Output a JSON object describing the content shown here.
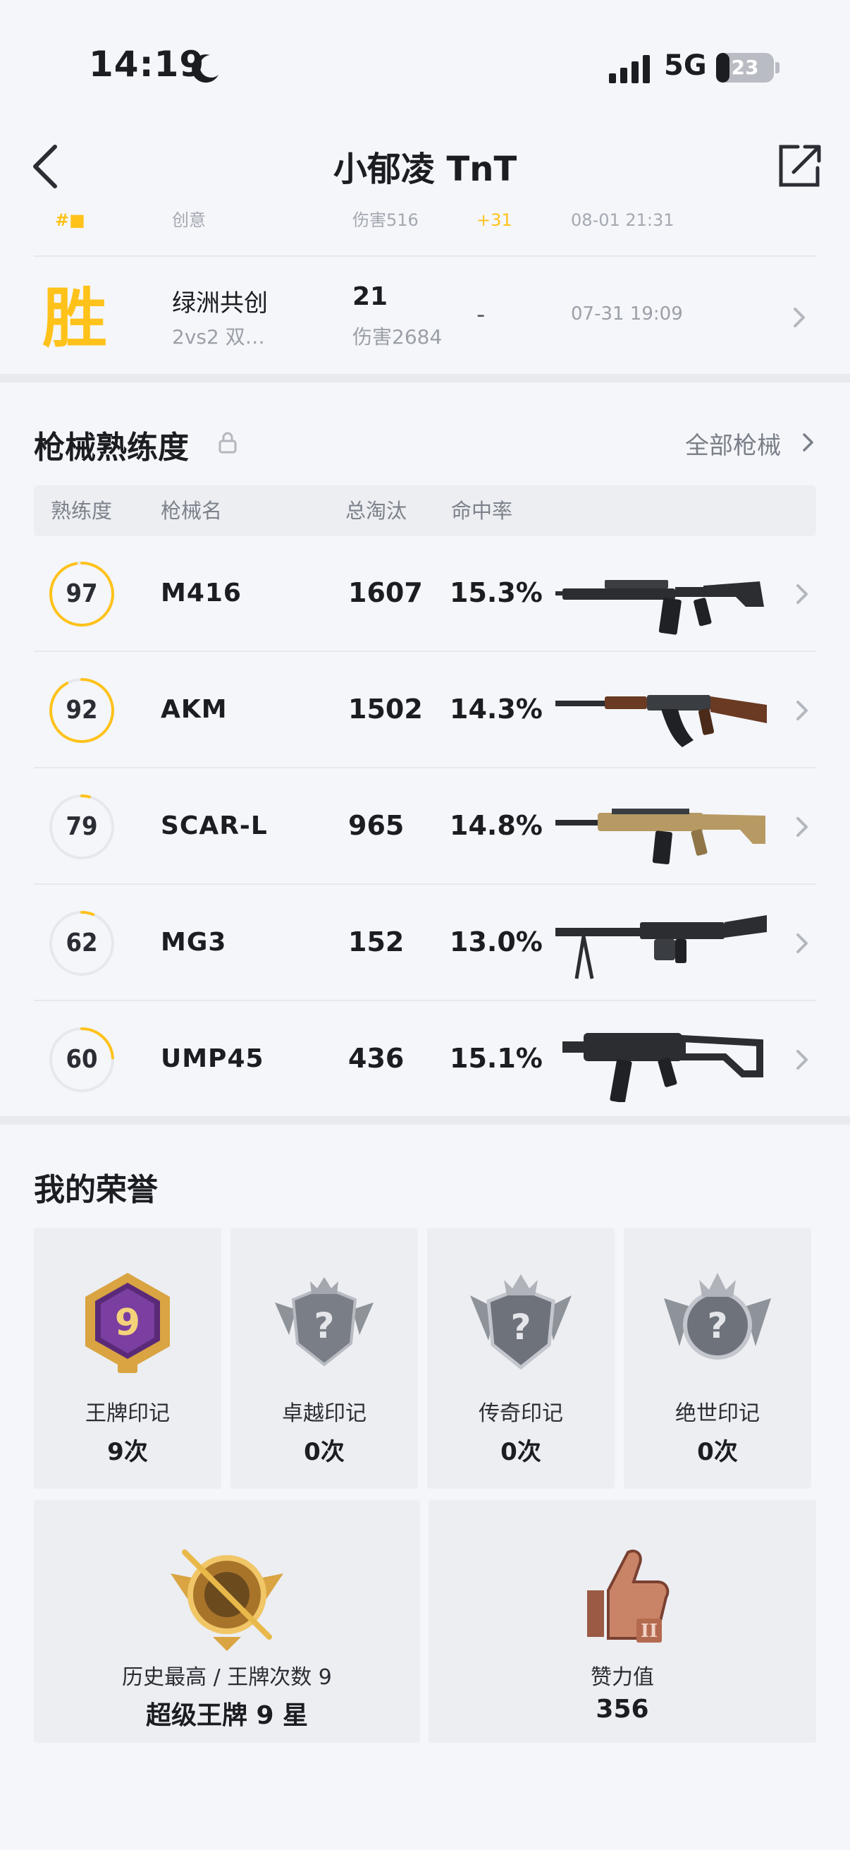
{
  "status_bar": {
    "time": "14:19",
    "network": "5G",
    "battery": "23",
    "battery_level": 0.23,
    "icons": [
      "moon-icon",
      "signal-icon",
      "battery-icon"
    ]
  },
  "nav": {
    "title": "小郁凌 TnT",
    "back_icon": "chevron-left-icon",
    "share_icon": "share-icon"
  },
  "matches": [
    {
      "result": "",
      "mode": "创意",
      "kills": "",
      "damage": "伤害516",
      "rank": "+31",
      "time": "08-01 21:31"
    },
    {
      "result": "胜",
      "mode": "绿洲共创",
      "mode_sub": "2vs2 双…",
      "kills": "21",
      "damage": "伤害2684",
      "rank": "-",
      "time": "07-31 19:09"
    }
  ],
  "weapons": {
    "title": "枪械熟练度",
    "all_link": "全部枪械",
    "headers": [
      "熟练度",
      "枪械名",
      "总淘汰",
      "命中率"
    ],
    "rows": [
      {
        "proficiency": "97",
        "level": 0.97,
        "name": "M416",
        "kills": "1607",
        "accuracy": "15.3%"
      },
      {
        "proficiency": "92",
        "level": 0.92,
        "name": "AKM",
        "kills": "1502",
        "accuracy": "14.3%"
      },
      {
        "proficiency": "79",
        "level": 0.04,
        "name": "SCAR-L",
        "kills": "965",
        "accuracy": "14.8%"
      },
      {
        "proficiency": "62",
        "level": 0.06,
        "name": "MG3",
        "kills": "152",
        "accuracy": "13.0%"
      },
      {
        "proficiency": "60",
        "level": 0.24,
        "name": "UMP45",
        "kills": "436",
        "accuracy": "15.1%"
      }
    ]
  },
  "honors": {
    "title": "我的荣誉",
    "badges": [
      {
        "label": "王牌印记",
        "count": "9次",
        "badge_number": "9",
        "icon": "ace-emblem-icon"
      },
      {
        "label": "卓越印记",
        "count": "0次",
        "icon": "locked-emblem-icon"
      },
      {
        "label": "传奇印记",
        "count": "0次",
        "icon": "locked-emblem-icon"
      },
      {
        "label": "绝世印记",
        "count": "0次",
        "icon": "locked-emblem-icon"
      }
    ],
    "highest": {
      "label": "历史最高 / 王牌次数 9",
      "value": "超级王牌 9 星",
      "icon": "ace-rank-emblem-icon"
    },
    "likes": {
      "label": "赞力值",
      "value": "356",
      "icon": "thumbs-up-icon"
    }
  },
  "colors": {
    "accent": "#ffc21a",
    "background": "#f4f6fa",
    "card": "#eceef2",
    "text_primary": "#1b1d21",
    "text_secondary": "#9b9fa7"
  }
}
